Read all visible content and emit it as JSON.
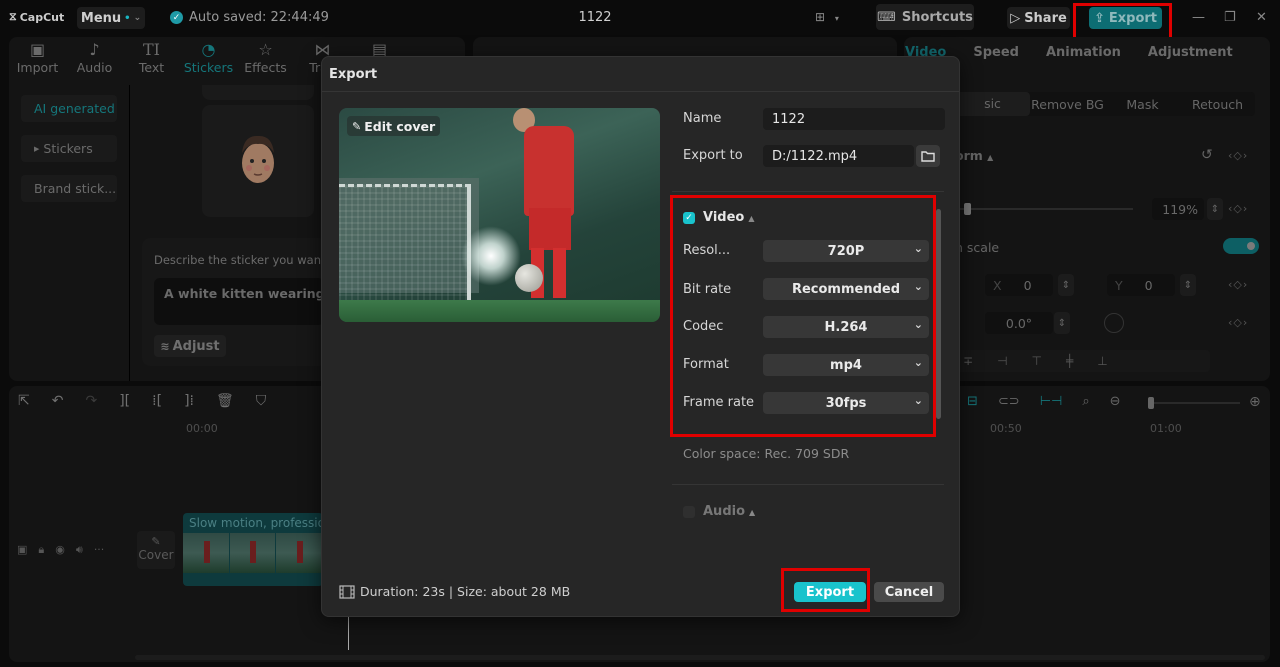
{
  "titlebar": {
    "logo": "CapCut",
    "menu_label": "Menu",
    "autosave": "Auto saved: 22:44:49",
    "project_title": "1122",
    "shortcuts_label": "Shortcuts",
    "share_label": "Share",
    "export_label": "Export"
  },
  "toolbar": {
    "tabs": [
      {
        "label": "Import",
        "icon": "import-icon"
      },
      {
        "label": "Audio",
        "icon": "audio-icon"
      },
      {
        "label": "Text",
        "icon": "text-icon"
      },
      {
        "label": "Stickers",
        "icon": "stickers-icon",
        "active": true
      },
      {
        "label": "Effects",
        "icon": "effects-icon"
      },
      {
        "label": "Tran",
        "icon": "transitions-icon"
      }
    ]
  },
  "sidebar": {
    "items": [
      {
        "label": "AI generated",
        "active": true
      },
      {
        "label": "Stickers"
      },
      {
        "label": "Brand stick..."
      }
    ]
  },
  "sticker_panel": {
    "prompt_label": "Describe the sticker you want t...",
    "prompt_value": "A white kitten wearing a c",
    "adjust_label": "Adjust"
  },
  "right_panel": {
    "tabs": [
      "Video",
      "Speed",
      "Animation",
      "Adjustment"
    ],
    "active_tab": "Video",
    "sub_tabs": [
      "sic",
      "Remove BG",
      "Mask",
      "Retouch"
    ],
    "section_label": "orm",
    "scale_value": "119%",
    "uniform_scale_label": "n scale",
    "uniform_scale_on": true,
    "pos_x_label": "X",
    "pos_x": "0",
    "pos_y_label": "Y",
    "pos_y": "0",
    "rotation": "0.0°"
  },
  "timeline": {
    "ruler": [
      "00:00",
      "00:50",
      "01:00"
    ],
    "clip_label": "Slow motion, professional",
    "cover_label": "Cover"
  },
  "export_dialog": {
    "title": "Export",
    "edit_cover_label": "Edit cover",
    "name_label": "Name",
    "name_value": "1122",
    "export_to_label": "Export to",
    "export_to_value": "D:/1122.mp4",
    "video": {
      "label": "Video",
      "checked": true,
      "settings": [
        {
          "label": "Resol...",
          "value": "720P"
        },
        {
          "label": "Bit rate",
          "value": "Recommended"
        },
        {
          "label": "Codec",
          "value": "H.264"
        },
        {
          "label": "Format",
          "value": "mp4"
        },
        {
          "label": "Frame rate",
          "value": "30fps"
        }
      ]
    },
    "color_space": "Color space: Rec. 709 SDR",
    "audio": {
      "label": "Audio",
      "checked": false
    },
    "footer_info": "Duration: 23s | Size: about 28 MB",
    "export_button": "Export",
    "cancel_button": "Cancel"
  },
  "colors": {
    "accent": "#19c3cc",
    "highlight": "#e00000"
  }
}
